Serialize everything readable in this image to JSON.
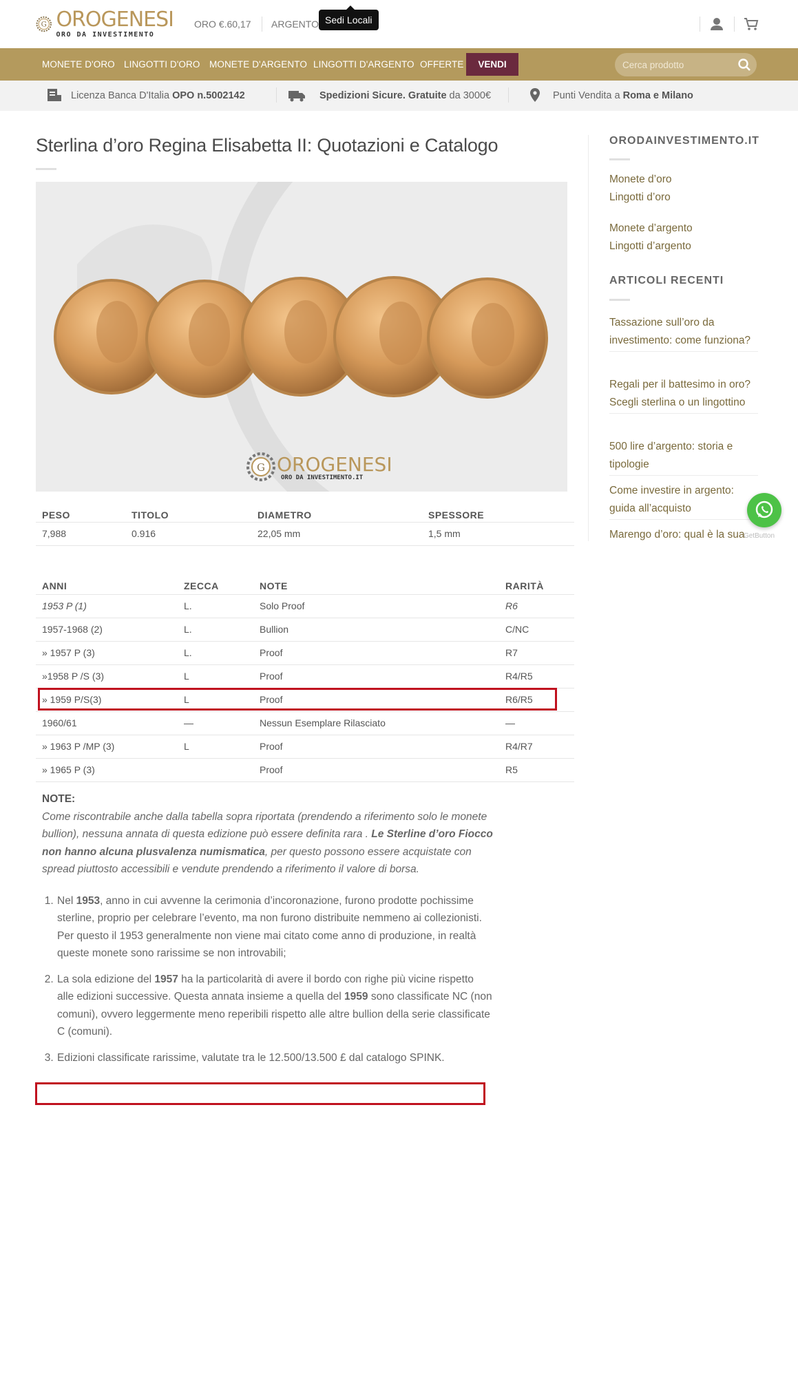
{
  "header": {
    "logo_main": "OROGENESI",
    "logo_sub": "ORO DA INVESTIMENTO",
    "gold_price": "ORO €.60,17",
    "silver_price": "ARGENTO",
    "tooltip": "Sedi Locali",
    "icons": [
      "user-icon",
      "cart-icon"
    ]
  },
  "nav": {
    "items": [
      "MONETE D'ORO",
      "LINGOTTI D'ORO",
      "MONETE D'ARGENTO",
      "LINGOTTI D'ARGENTO",
      "OFFERTE"
    ],
    "vendi": "VENDI",
    "search_placeholder": "Cerca prodotto"
  },
  "infobar": {
    "license_label": "Licenza Banca D'Italia",
    "license_code": "OPO n.5002142",
    "shipping_bold": "Spedizioni Sicure. Gratuite",
    "shipping_rest": "da 3000€",
    "stores_label": "Punti Vendita a",
    "stores_bold": "Roma e Milano"
  },
  "main": {
    "title": "Sterlina d’oro Regina Elisabetta II: Quotazioni e Catalogo",
    "hero_watermark": "OROGENESI",
    "hero_watermark_sub": "ORO DA INVESTIMENTO.IT",
    "specs": {
      "headers": [
        "PESO",
        "TITOLO",
        "DIAMETRO",
        "SPESSORE"
      ],
      "values": [
        "7,988",
        "0.916",
        "22,05 mm",
        "1,5 mm"
      ]
    },
    "years": {
      "headers": [
        "ANNI",
        "ZECCA",
        "NOTE",
        "RARITÀ"
      ],
      "rows": [
        [
          "1953 P (1)",
          "L.",
          "Solo Proof",
          "R6"
        ],
        [
          "1957-1968 (2)",
          "L.",
          "Bullion",
          "C/NC"
        ],
        [
          "» 1957 P (3)",
          "L.",
          "Proof",
          "R7"
        ],
        [
          "»1958 P /S (3)",
          "L",
          "Proof",
          "R4/R5"
        ],
        [
          "» 1959 P/S(3)",
          "L",
          "Proof",
          "R6/R5"
        ],
        [
          "1960/61",
          "—",
          "Nessun Esemplare Rilasciato",
          "—"
        ],
        [
          "» 1963 P /MP (3)",
          "L",
          "Proof",
          "R4/R7"
        ],
        [
          "» 1965 P (3)",
          "",
          "Proof",
          "R5"
        ]
      ]
    },
    "notes": {
      "heading": "NOTE:",
      "text_1": "Come riscontrabile anche dalla tabella sopra riportata (prendendo a riferimento solo le monete bullion), nessuna annata di questa edizione può essere definita rara . ",
      "text_bold": "Le Sterline d’oro Fiocco non hanno alcuna plusvalenza numismatica",
      "text_2": ", per questo possono essere acquistate con spread piuttosto accessibili e vendute prendendo a riferimento il valore di borsa.",
      "item1_a": "Nel ",
      "item1_b": "1953",
      "item1_c": ", anno in cui avvenne la cerimonia d’incoronazione, furono prodotte pochissime sterline, proprio per celebrare l’evento, ma non furono distribuite nemmeno ai collezionisti. Per questo il 1953 generalmente non viene mai citato come anno di produzione, in realtà queste monete sono rarissime se non introvabili;",
      "item2_a": "La sola edizione del ",
      "item2_b": "1957",
      "item2_c": " ha la particolarità di avere il bordo con righe più vicine rispetto alle edizioni successive. Questa annata insieme a quella del ",
      "item2_d": "1959",
      "item2_e": " sono classificate NC (non comuni), ovvero leggermente meno reperibili rispetto alle altre bullion della serie classificate C (comuni).",
      "item3": "Edizioni classificate rarissime, valutate tra le 12.500/13.500 £ dal catalogo SPINK."
    }
  },
  "sidebar": {
    "title1": "ORODAINVESTIMENTO.IT",
    "links": [
      "Monete d’oro",
      "Lingotti d’oro",
      "Monete d’argento",
      "Lingotti d’argento"
    ],
    "title2": "ARTICOLI RECENTI",
    "posts": [
      "Tassazione sull’oro da investimento: come funziona?",
      "Regali per il battesimo in oro? Scegli sterlina o un lingottino",
      "500 lire d’argento: storia e tipologie",
      "Come investire in argento: guida all’acquisto",
      "Marengo d’oro: qual è la sua"
    ]
  },
  "widget": {
    "label": "GetButton"
  },
  "colors": {
    "gold": "#b49a5d",
    "vendi": "#6b2a3e",
    "link": "#7a6a3c",
    "highlight": "#c0111f",
    "whatsapp": "#4dc247"
  }
}
